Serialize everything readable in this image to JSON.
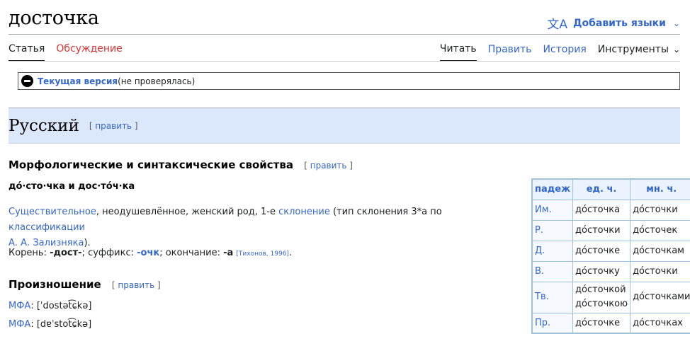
{
  "title": "досточка",
  "lang_button": {
    "icon": "translate-icon",
    "label": "Добавить языки"
  },
  "tabs_left": [
    {
      "label": "Статья",
      "active": true
    },
    {
      "label": "Обсуждение",
      "active": false
    }
  ],
  "tabs_right": [
    {
      "label": "Читать",
      "active": true
    },
    {
      "label": "Править"
    },
    {
      "label": "История"
    },
    {
      "label": "Инструменты"
    }
  ],
  "version": {
    "current": "Текущая версия",
    "note": "(не проверялась)"
  },
  "language_section": {
    "heading": "Русский",
    "edit": "править"
  },
  "morph": {
    "heading": "Морфологические и синтаксические свойства",
    "edit": "править",
    "forms": "до́·сто·чка и дос·то́ч·ка",
    "line1_link1": "Существительное",
    "line1_text1": ", неодушевлённое, женский род, 1-е ",
    "line1_link2": "склонение",
    "line1_text2": " (тип склонения 3*a по ",
    "line1_link3": "классификации",
    "line1_link4": "А. А. Зализняка",
    "line1_text3": ").",
    "root_label": "Корень: ",
    "root": "-дост-",
    "suffix_label": "; суффикс: ",
    "suffix": "-очк",
    "ending_label": "; окончание: ",
    "ending": "-а",
    "ref": "[Тихонов, 1996]",
    "end": "."
  },
  "pron": {
    "heading": "Произношение",
    "edit": "править",
    "lines": [
      {
        "label": "МФА",
        "value": ": [ˈdostət͡ɕkə]"
      },
      {
        "label": "МФА",
        "value": ": [dɐˈstot͡ɕkə]"
      }
    ]
  },
  "table": {
    "headers": [
      "падеж",
      "ед. ч.",
      "мн. ч."
    ],
    "rows": [
      {
        "case": "Им.",
        "sg": "до́сточка",
        "pl": "до́сточки"
      },
      {
        "case": "Р.",
        "sg": "до́сточки",
        "pl": "до́сточек"
      },
      {
        "case": "Д.",
        "sg": "до́сточке",
        "pl": "до́сточкам"
      },
      {
        "case": "В.",
        "sg": "до́сточку",
        "pl": "до́сточки"
      },
      {
        "case": "Тв.",
        "sg": "до́сточкой",
        "sg2": "до́сточкою",
        "pl": "до́сточками"
      },
      {
        "case": "Пр.",
        "sg": "до́сточке",
        "pl": "до́сточках"
      }
    ]
  }
}
